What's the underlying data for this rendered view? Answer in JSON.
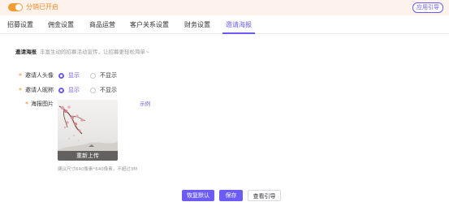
{
  "topbar": {
    "status": "分销已开启",
    "guide_button": "应用引导"
  },
  "tabs": [
    {
      "label": "招募设置"
    },
    {
      "label": "佣金设置"
    },
    {
      "label": "商品运营"
    },
    {
      "label": "客户关系设置"
    },
    {
      "label": "财务设置"
    },
    {
      "label": "邀请海报",
      "active": true
    }
  ],
  "section": {
    "title": "邀请海报",
    "description": "丰富生动的招募活动宣传，让招募更轻松简单~"
  },
  "form": {
    "avatar": {
      "label": "邀请人头像",
      "options": [
        "显示",
        "不显示"
      ],
      "selected": "显示"
    },
    "nickname": {
      "label": "邀请人昵称",
      "options": [
        "显示",
        "不显示"
      ],
      "selected": "显示"
    },
    "poster": {
      "label": "海报图片",
      "example_link": "示例",
      "reupload_label": "重新上传",
      "hint": "建议尺寸640像素*640像素，不超过3M"
    }
  },
  "actions": {
    "reset": "恢复默认",
    "save": "保存",
    "view_guide": "查看引导"
  },
  "colors": {
    "accent": "#6b5cf6",
    "orange": "#f08a24"
  }
}
